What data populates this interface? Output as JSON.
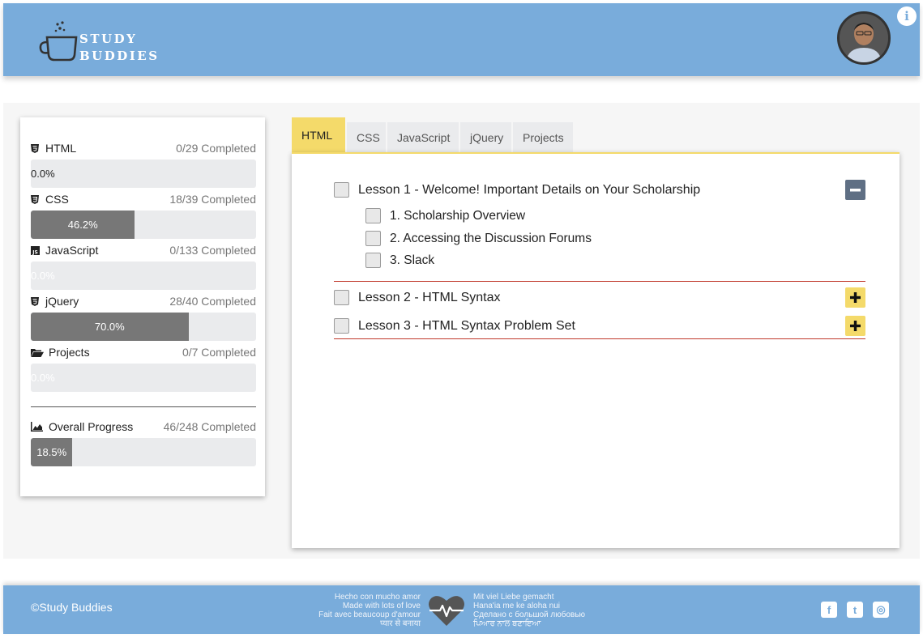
{
  "header": {
    "brand_line1": "STUDY",
    "brand_line2": "BUDDIES",
    "info_label": "i"
  },
  "progress": {
    "items": [
      {
        "name": "HTML",
        "count": "0/29 Completed",
        "percent_label": "0.0%",
        "percent": 0.0,
        "icon": "html5-icon"
      },
      {
        "name": "CSS",
        "count": "18/39 Completed",
        "percent_label": "46.2%",
        "percent": 46.2,
        "icon": "css3-icon"
      },
      {
        "name": "JavaScript",
        "count": "0/133 Completed",
        "percent_label": "0.0%",
        "percent": 0.0,
        "icon": "js-icon"
      },
      {
        "name": "jQuery",
        "count": "28/40 Completed",
        "percent_label": "70.0%",
        "percent": 70.0,
        "icon": "html5-icon"
      },
      {
        "name": "Projects",
        "count": "0/7 Completed",
        "percent_label": "0.0%",
        "percent": 0.0,
        "icon": "folder-open-icon"
      }
    ],
    "overall": {
      "name": "Overall Progress",
      "count": "46/248 Completed",
      "percent_label": "18.5%",
      "percent": 18.5,
      "icon": "area-chart-icon"
    }
  },
  "tabs": [
    {
      "label": "HTML",
      "active": true
    },
    {
      "label": "CSS",
      "active": false
    },
    {
      "label": "JavaScript",
      "active": false
    },
    {
      "label": "jQuery",
      "active": false
    },
    {
      "label": "Projects",
      "active": false
    }
  ],
  "lessons": [
    {
      "title": "Lesson 1 - Welcome! Important Details on Your Scholarship",
      "expanded": true,
      "subitems": [
        {
          "title": "1. Scholarship Overview"
        },
        {
          "title": "2. Accessing the Discussion Forums"
        },
        {
          "title": "3. Slack"
        }
      ]
    },
    {
      "title": "Lesson 2 - HTML Syntax",
      "expanded": false
    },
    {
      "title": "Lesson 3 - HTML Syntax Problem Set",
      "expanded": false
    }
  ],
  "footer": {
    "copyright": "©Study Buddies",
    "love_left": [
      "Hecho con mucho amor",
      "Made with lots of love",
      "Fait avec beaucoup d'amour",
      "प्यार से बनाया"
    ],
    "love_right": [
      "Mit viel Liebe gemacht",
      "Hana'ia me ke aloha nui",
      "Сделано с большой любовью",
      "ਪਿਆਰ ਨਾਲ ਬਣਾਇਆ"
    ],
    "socials": [
      {
        "name": "facebook-icon",
        "glyph": "f"
      },
      {
        "name": "twitter-icon",
        "glyph": "t"
      },
      {
        "name": "instagram-icon",
        "glyph": "◎"
      }
    ]
  },
  "colors": {
    "header_bg": "#79acdb",
    "tab_active": "#f4da6a",
    "progress_fill": "#777777",
    "separator": "#c0392b",
    "minus_btn": "#5f6f84"
  }
}
